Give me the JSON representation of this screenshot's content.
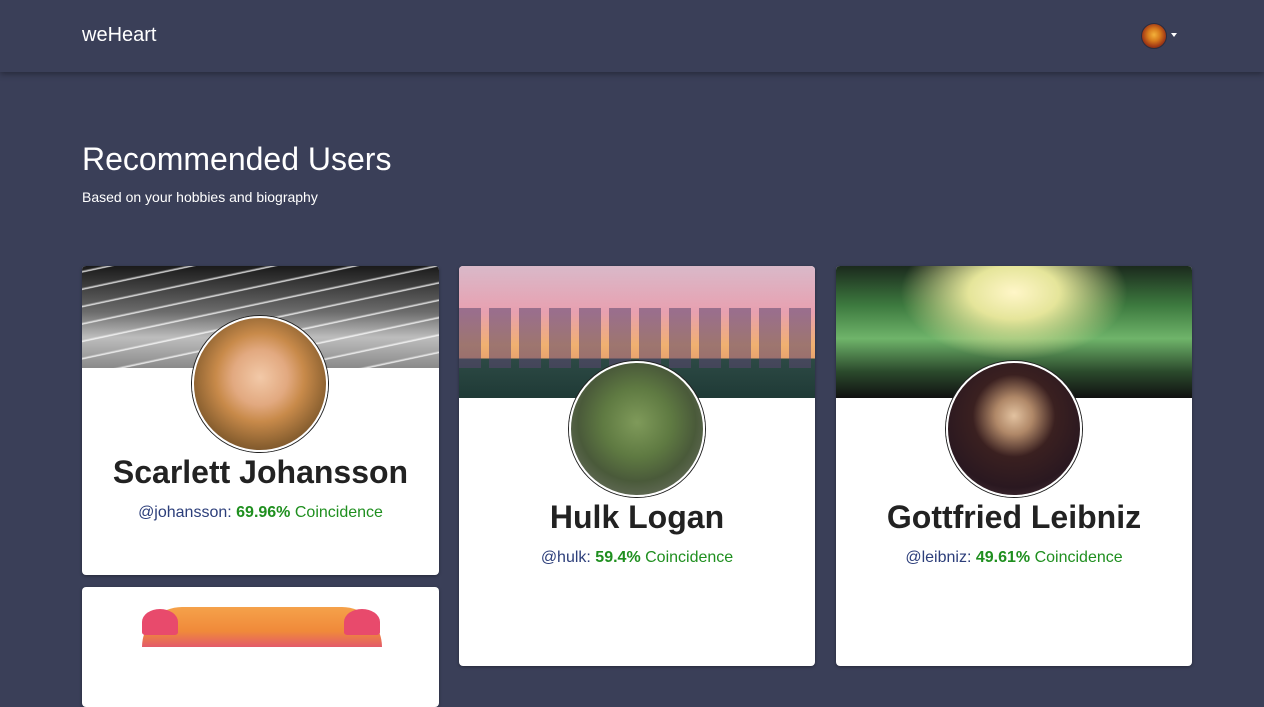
{
  "navbar": {
    "brand": "weHeart",
    "user_avatar_icon": "user-avatar-icon"
  },
  "page": {
    "title": "Recommended Users",
    "subtitle": "Based on your hobbies and biography"
  },
  "users": [
    {
      "name": "Scarlett Johansson",
      "username": "@johansson",
      "percent": "69.96%",
      "coincidence_label": "Coincidence"
    },
    {
      "name": "Hulk Logan",
      "username": "@hulk",
      "percent": "59.4%",
      "coincidence_label": "Coincidence"
    },
    {
      "name": "Gottfried Leibniz",
      "username": "@leibniz",
      "percent": "49.61%",
      "coincidence_label": "Coincidence"
    }
  ],
  "colors": {
    "background": "#3a3f58",
    "card": "#ffffff",
    "username": "#2c3e7a",
    "coincidence": "#1f8f1f"
  }
}
